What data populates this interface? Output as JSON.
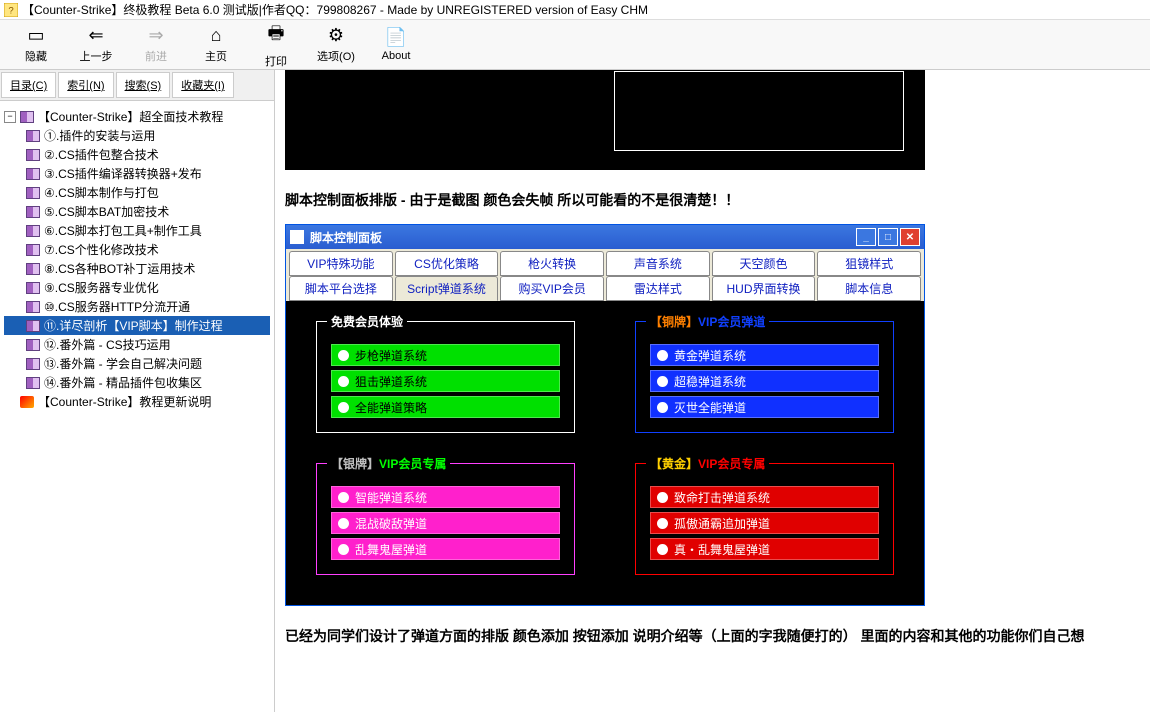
{
  "window_title": "【Counter-Strike】终极教程 Beta 6.0 测试版|作者QQ：799808267 - Made by UNREGISTERED version of Easy CHM",
  "toolbar": {
    "hide": "隐藏",
    "back": "上一步",
    "forward": "前进",
    "home": "主页",
    "print": "打印",
    "options": "选项(O)",
    "about": "About"
  },
  "sidebar_tabs": {
    "contents": "目录(C)",
    "index": "索引(N)",
    "search": "搜索(S)",
    "favorites": "收藏夹(I)"
  },
  "tree": {
    "root": "【Counter-Strike】超全面技术教程",
    "items": [
      "①.插件的安装与运用",
      "②.CS插件包整合技术",
      "③.CS插件编译器转换器+发布",
      "④.CS脚本制作与打包",
      "⑤.CS脚本BAT加密技术",
      "⑥.CS脚本打包工具+制作工具",
      "⑦.CS个性化修改技术",
      "⑧.CS各种BOT补丁运用技术",
      "⑨.CS服务器专业优化",
      "⑩.CS服务器HTTP分流开通",
      "⑪.详尽剖析【VIP脚本】制作过程",
      "⑫.番外篇 - CS技巧运用",
      "⑬.番外篇 - 学会自己解决问题",
      "⑭.番外篇 - 精品插件包收集区"
    ],
    "update": "【Counter-Strike】教程更新说明"
  },
  "caption": "脚本控制面板排版 - 由于是截图 颜色会失帧 所以可能看的不是很清楚！！",
  "panel": {
    "title": "脚本控制面板",
    "tabs_row1": [
      "VIP特殊功能",
      "CS优化策略",
      "枪火转换",
      "声音系统",
      "天空颜色",
      "狙镜样式"
    ],
    "tabs_row2": [
      "脚本平台选择",
      "Script弹道系统",
      "购买VIP会员",
      "雷达样式",
      "HUD界面转换",
      "脚本信息"
    ],
    "groups": {
      "free": {
        "title": "免费会员体验",
        "opts": [
          "步枪弹道系统",
          "狙击弹道系统",
          "全能弹道策略"
        ]
      },
      "bronze": {
        "tier": "【铜牌】",
        "title": "VIP会员弹道",
        "opts": [
          "黄金弹道系统",
          "超稳弹道系统",
          "灭世全能弹道"
        ]
      },
      "silver": {
        "tier": "【银牌】",
        "title": "VIP会员专属",
        "opts": [
          "智能弹道系统",
          "混战破敌弹道",
          "乱舞鬼屋弹道"
        ]
      },
      "gold": {
        "tier": "【黄金】",
        "title": "VIP会员专属",
        "opts": [
          "致命打击弹道系统",
          "孤傲通霸追加弹道",
          "真・乱舞鬼屋弹道"
        ]
      }
    }
  },
  "footer": "已经为同学们设计了弹道方面的排版 颜色添加 按钮添加 说明介绍等（上面的字我随便打的） 里面的内容和其他的功能你们自己想"
}
